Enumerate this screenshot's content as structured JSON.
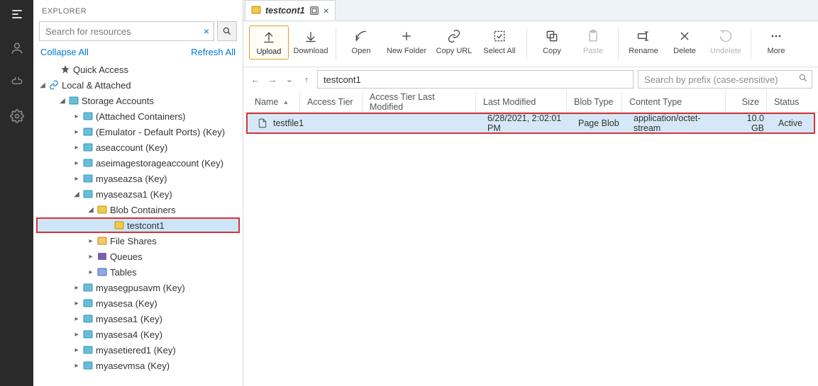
{
  "explorer": {
    "title": "EXPLORER",
    "search_placeholder": "Search for resources",
    "collapse_all": "Collapse All",
    "refresh_all": "Refresh All",
    "quick_access": "Quick Access",
    "local_attached": "Local & Attached",
    "storage_accounts": "Storage Accounts",
    "accounts": [
      "(Attached Containers)",
      "(Emulator - Default Ports) (Key)",
      "aseaccount (Key)",
      "aseimagestorageaccount (Key)",
      "myaseazsa (Key)"
    ],
    "expanded_account": "myaseazsa1 (Key)",
    "blob_containers": "Blob Containers",
    "selected_container": "testcont1",
    "siblings": [
      "File Shares",
      "Queues",
      "Tables"
    ],
    "accounts_after": [
      "myasegpusavm (Key)",
      "myasesa (Key)",
      "myasesa1 (Key)",
      "myasesa4 (Key)",
      "myasetiered1 (Key)",
      "myasevmsa (Key)"
    ]
  },
  "tab": {
    "title": "testcont1"
  },
  "toolbar": {
    "upload": "Upload",
    "download": "Download",
    "open": "Open",
    "new_folder": "New Folder",
    "copy_url": "Copy URL",
    "select_all": "Select All",
    "copy": "Copy",
    "paste": "Paste",
    "rename": "Rename",
    "delete": "Delete",
    "undelete": "Undelete",
    "more": "More"
  },
  "nav": {
    "path": "testcont1",
    "prefix_placeholder": "Search by prefix (case-sensitive)"
  },
  "columns": {
    "name": "Name",
    "access_tier": "Access Tier",
    "access_tier_lm": "Access Tier Last Modified",
    "last_modified": "Last Modified",
    "blob_type": "Blob Type",
    "content_type": "Content Type",
    "size": "Size",
    "status": "Status"
  },
  "row": {
    "name": "testfile1",
    "access_tier": "",
    "access_tier_lm": "",
    "last_modified": "6/28/2021, 2:02:01 PM",
    "blob_type": "Page Blob",
    "content_type": "application/octet-stream",
    "size": "10.0 GB",
    "status": "Active"
  }
}
